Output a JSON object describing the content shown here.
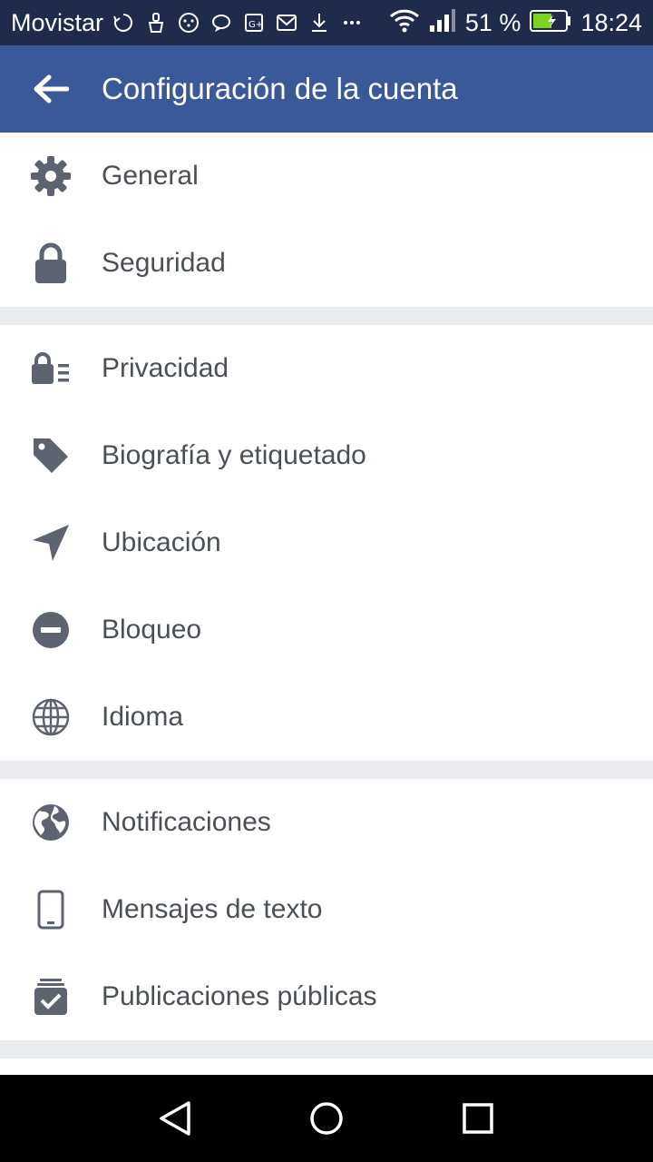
{
  "status_bar": {
    "carrier": "Movistar",
    "battery_percent": "51 %",
    "time": "18:24",
    "icons": [
      "sync-icon",
      "cleaner-icon",
      "dots-icon",
      "chat-icon",
      "google-plus-icon",
      "gmail-icon",
      "download-icon",
      "more-icon",
      "wifi-icon",
      "signal-icon",
      "battery-icon"
    ]
  },
  "app_bar": {
    "title": "Configuración de la cuenta",
    "back_icon": "arrow-left-icon",
    "background": "#3b5998"
  },
  "settings": {
    "group1": [
      {
        "label": "General",
        "icon": "gear-icon"
      },
      {
        "label": "Seguridad",
        "icon": "lock-icon"
      }
    ],
    "group2": [
      {
        "label": "Privacidad",
        "icon": "privacy-lock-icon"
      },
      {
        "label": "Biografía y etiquetado",
        "icon": "tag-icon"
      },
      {
        "label": "Ubicación",
        "icon": "location-arrow-icon"
      },
      {
        "label": "Bloqueo",
        "icon": "block-icon"
      },
      {
        "label": "Idioma",
        "icon": "globe-outline-icon"
      }
    ],
    "group3": [
      {
        "label": "Notificaciones",
        "icon": "globe-icon"
      },
      {
        "label": "Mensajes de texto",
        "icon": "phone-icon"
      },
      {
        "label": "Publicaciones públicas",
        "icon": "public-posts-icon"
      }
    ]
  },
  "colors": {
    "icon": "#5d6470",
    "text": "#4b4f56",
    "separator": "#e9ebee",
    "status_bar": "#1f2b4a"
  },
  "nav_bar": {
    "buttons": [
      "back-triangle-icon",
      "home-circle-icon",
      "recents-square-icon"
    ]
  }
}
